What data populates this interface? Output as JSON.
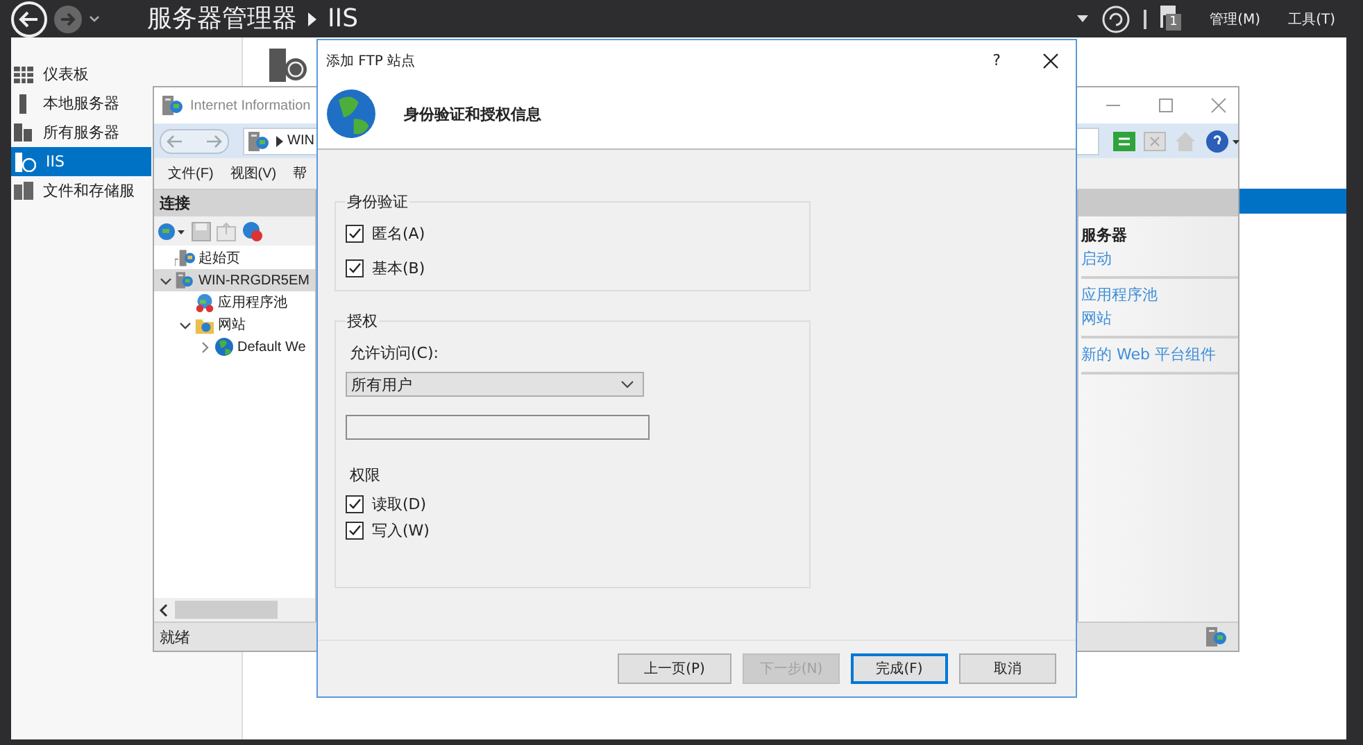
{
  "server_manager": {
    "title": "服务器管理器",
    "breadcrumb": "IIS",
    "menu": [
      "管理(M)",
      "工具(T)"
    ],
    "notification_count": "1",
    "sidebar": {
      "items": [
        {
          "label": "仪表板",
          "kind": "grid",
          "selected": false
        },
        {
          "label": "本地服务器",
          "kind": "bar",
          "selected": false
        },
        {
          "label": "所有服务器",
          "kind": "servers",
          "selected": false
        },
        {
          "label": "IIS",
          "kind": "iis",
          "selected": true
        },
        {
          "label": "文件和存储服",
          "kind": "storage",
          "selected": false
        }
      ]
    }
  },
  "iis_window": {
    "title": "Internet Information",
    "address": "WIN",
    "menu": [
      "文件(F)",
      "视图(V)",
      "帮"
    ],
    "connections": {
      "title": "连接",
      "tree": [
        {
          "label": "起始页",
          "kind": "home",
          "selected": false
        },
        {
          "label": "WIN-RRGDR5EM",
          "kind": "server",
          "selected": true,
          "expanded": true,
          "children": [
            {
              "label": "应用程序池",
              "kind": "pool",
              "selected": false
            },
            {
              "label": "网站",
              "kind": "folder",
              "selected": false,
              "expanded": true,
              "children": [
                {
                  "label": "Default We",
                  "kind": "site",
                  "selected": false,
                  "expanded": false
                }
              ]
            }
          ]
        }
      ]
    },
    "actions": {
      "heading": "服务器",
      "groups": [
        {
          "links": [
            "启动"
          ]
        },
        {
          "links": [
            "应用程序池",
            "网站"
          ]
        },
        {
          "links": [
            "新的 Web 平台组件"
          ]
        }
      ]
    },
    "status": "就绪"
  },
  "dialog": {
    "title": "添加 FTP 站点",
    "help": "?",
    "heading": "身份验证和授权信息",
    "authentication": {
      "title": "身份验证",
      "options": [
        {
          "label": "匿名(A)",
          "checked": true
        },
        {
          "label": "基本(B)",
          "checked": true
        }
      ]
    },
    "authorization": {
      "title": "授权",
      "access_label": "允许访问(C):",
      "access_value": "所有用户",
      "permissions_label": "权限",
      "permissions": [
        {
          "label": "读取(D)",
          "checked": true
        },
        {
          "label": "写入(W)",
          "checked": true
        }
      ]
    },
    "buttons": [
      {
        "label": "上一页(P)",
        "disabled": false,
        "default": false
      },
      {
        "label": "下一步(N)",
        "disabled": true,
        "default": false
      },
      {
        "label": "完成(F)",
        "disabled": false,
        "default": true
      },
      {
        "label": "取消",
        "disabled": false,
        "default": false
      }
    ]
  }
}
